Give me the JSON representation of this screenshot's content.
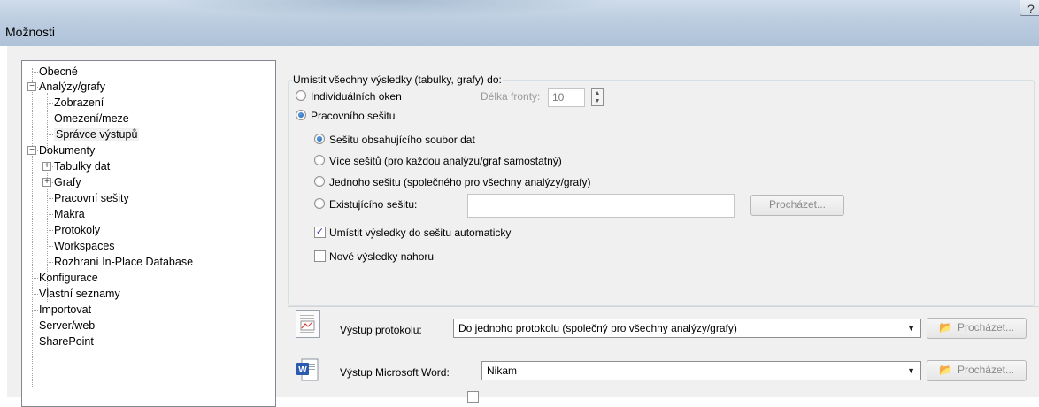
{
  "window": {
    "title": "Možnosti",
    "help_label": "?"
  },
  "tree": {
    "items": [
      {
        "label": "Obecné"
      },
      {
        "label": "Analýzy/grafy",
        "expander": "−"
      },
      {
        "label": "Zobrazení"
      },
      {
        "label": "Omezení/meze"
      },
      {
        "label": "Správce výstupů",
        "selected": true
      },
      {
        "label": "Dokumenty",
        "expander": "−"
      },
      {
        "label": "Tabulky dat",
        "expander": "+"
      },
      {
        "label": "Grafy",
        "expander": "+"
      },
      {
        "label": "Pracovní sešity"
      },
      {
        "label": "Makra"
      },
      {
        "label": "Protokoly"
      },
      {
        "label": "Workspaces"
      },
      {
        "label": "Rozhraní In-Place Database"
      },
      {
        "label": "Konfigurace"
      },
      {
        "label": "Vlastní seznamy"
      },
      {
        "label": "Importovat"
      },
      {
        "label": "Server/web"
      },
      {
        "label": "SharePoint"
      }
    ]
  },
  "placement": {
    "group_label": "Umístit všechny výsledky (tabulky, grafy) do:",
    "individual_windows": "Individuálních oken",
    "queue_length_label": "Délka fronty:",
    "queue_length_value": "10",
    "workbook": "Pracovního sešitu",
    "options": [
      "Sešitu obsahujícího soubor dat",
      "Více sešitů (pro každou analýzu/graf samostatný)",
      "Jednoho sešitu (společného pro všechny analýzy/grafy)",
      "Existujícího sešitu:"
    ],
    "existing_value": "",
    "browse_label": "Procházet...",
    "auto_place": "Umístit výsledky do sešitu automaticky",
    "auto_place_checked": true,
    "new_on_top": "Nové výsledky nahoru",
    "new_on_top_checked": false
  },
  "protocol_output": {
    "label": "Výstup protokolu:",
    "value": "Do jednoho protokolu (společný pro všechny analýzy/grafy)",
    "browse_label": "Procházet..."
  },
  "word_output": {
    "label": "Výstup Microsoft Word:",
    "value": "Nikam",
    "browse_label": "Procházet..."
  }
}
